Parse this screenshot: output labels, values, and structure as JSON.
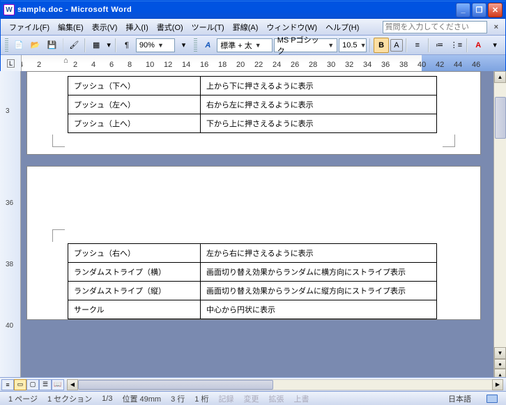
{
  "title": "sample.doc - Microsoft Word",
  "menu": {
    "file": "ファイル(F)",
    "edit": "編集(E)",
    "view": "表示(V)",
    "insert": "挿入(I)",
    "format": "書式(O)",
    "tool": "ツール(T)",
    "ruled": "罫線(A)",
    "window": "ウィンドウ(W)",
    "help": "ヘルプ(H)",
    "ask_placeholder": "質問を入力してください"
  },
  "toolbar": {
    "zoom": "90%",
    "style": "標準 + 太",
    "font": "MS Pゴシック",
    "size": "10.5"
  },
  "ruler_marks": [
    4,
    2,
    "",
    2,
    4,
    6,
    8,
    10,
    12,
    14,
    16,
    18,
    20,
    22,
    24,
    26,
    28,
    30,
    32,
    34,
    36,
    38,
    40,
    42,
    44,
    46
  ],
  "ruler_values": [
    "4",
    "2",
    "",
    "2",
    "4",
    "6",
    "8",
    "10",
    "12",
    "14",
    "16",
    "18",
    "20",
    "22",
    "24",
    "26",
    "28",
    "30",
    "32",
    "34",
    "36",
    "38",
    "40",
    "42",
    "44",
    "46"
  ],
  "blue_ruler": [
    "40",
    "42",
    "44",
    "46"
  ],
  "vruler": [
    "",
    "3",
    "",
    "",
    "36",
    "",
    "38",
    "",
    "40",
    ""
  ],
  "table1": [
    {
      "l": "プッシュ（下へ）",
      "r": "上から下に押さえるように表示"
    },
    {
      "l": "プッシュ（左へ）",
      "r": "右から左に押さえるように表示"
    },
    {
      "l": "プッシュ（上へ）",
      "r": "下から上に押さえるように表示"
    }
  ],
  "table2": [
    {
      "l": "プッシュ（右へ）",
      "r": "左から右に押さえるように表示"
    },
    {
      "l": "ランダムストライプ（横）",
      "r": "画面切り替え効果からランダムに横方向にストライプ表示"
    },
    {
      "l": "ランダムストライプ（縦）",
      "r": "画面切り替え効果からランダムに縦方向にストライプ表示"
    },
    {
      "l": "サークル",
      "r": "中心から円状に表示"
    }
  ],
  "status": {
    "page": "1 ページ",
    "section": "1 セクション",
    "pages": "1/3",
    "pos": "位置 49mm",
    "line": "3 行",
    "col": "1 桁",
    "rec": "記録",
    "rev": "変更",
    "ext": "拡張",
    "ovr": "上書",
    "lang": "日本語"
  }
}
